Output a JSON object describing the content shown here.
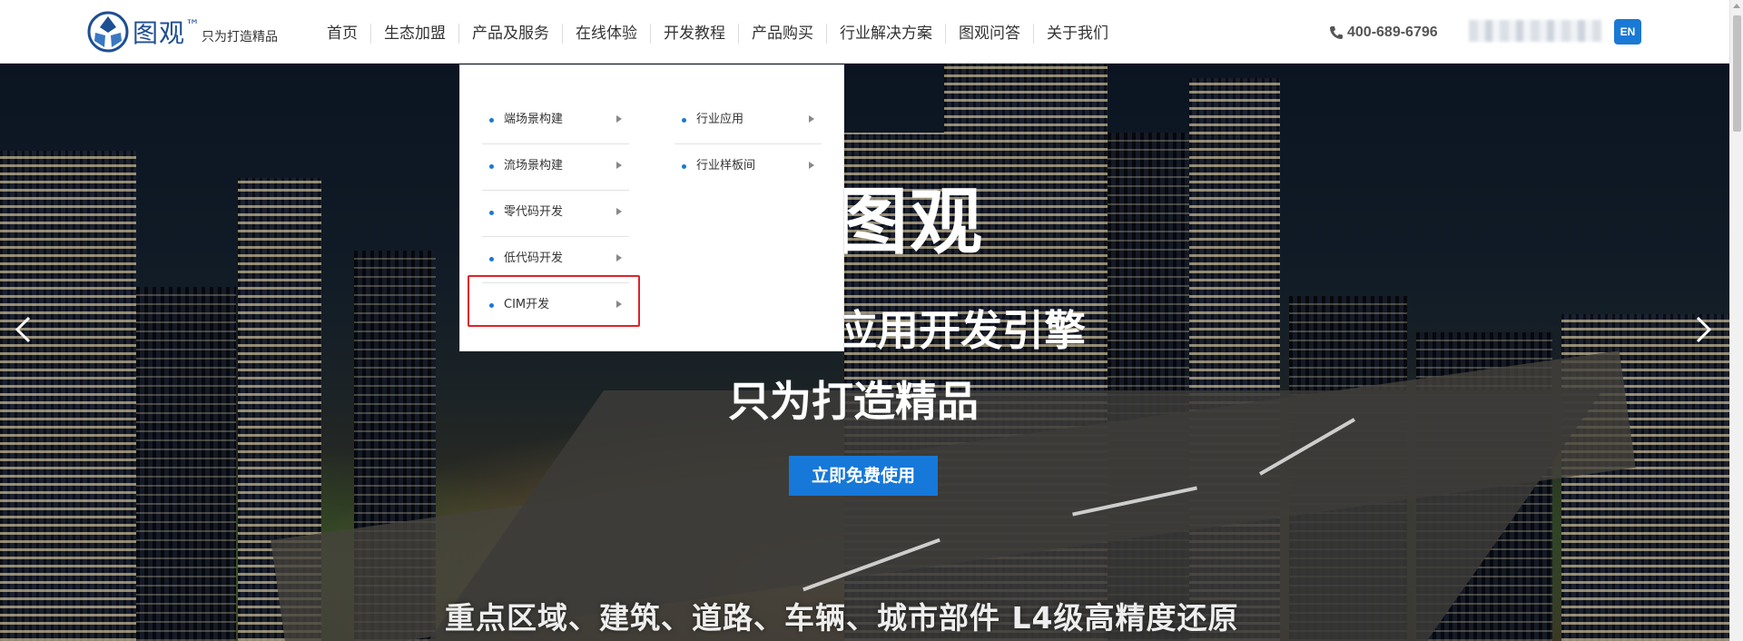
{
  "brand": {
    "name": "图观",
    "tm": "™",
    "slogan": "只为打造精品"
  },
  "nav": {
    "items": [
      {
        "label": "首页"
      },
      {
        "label": "生态加盟"
      },
      {
        "label": "产品及服务"
      },
      {
        "label": "在线体验"
      },
      {
        "label": "开发教程"
      },
      {
        "label": "产品购买"
      },
      {
        "label": "行业解决方案"
      },
      {
        "label": "图观问答"
      },
      {
        "label": "关于我们"
      }
    ]
  },
  "phone": "400-689-6796",
  "lang_button": "EN",
  "dropdown": {
    "col1": [
      {
        "label": "端场景构建"
      },
      {
        "label": "流场景构建"
      },
      {
        "label": "零代码开发"
      },
      {
        "label": "低代码开发"
      },
      {
        "label": "CIM开发"
      }
    ],
    "col2": [
      {
        "label": "行业应用"
      },
      {
        "label": "行业样板间"
      }
    ],
    "highlighted": "CIM开发"
  },
  "hero": {
    "title": "图观",
    "line1": "应用开发引擎",
    "line2": "只为打造精品",
    "cta": "立即免费使用",
    "bottom_text": "重点区域、建筑、道路、车辆、城市部件 L4级高精度还原"
  },
  "colors": {
    "brand_blue": "#1e4f93",
    "accent_blue": "#1678d8",
    "highlight_red": "#e0222a"
  },
  "icons": [
    "logo-icon",
    "phone-icon",
    "chevron-left-icon",
    "chevron-right-icon",
    "caret-right-icon"
  ]
}
